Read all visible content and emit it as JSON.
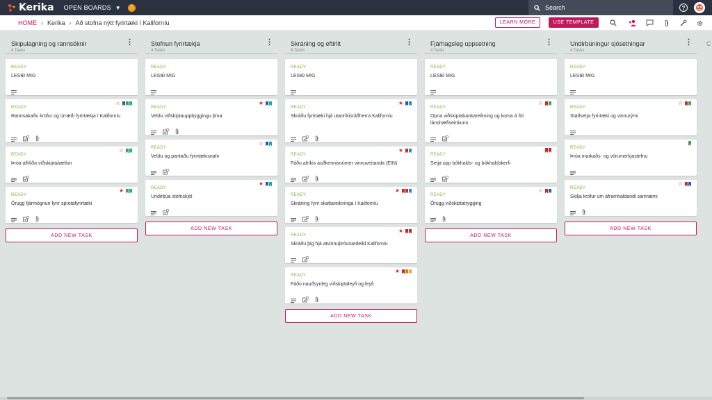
{
  "app": {
    "logo_text": "Kerika",
    "open_boards_label": "OPEN BOARDS",
    "notification_glyph": "!",
    "search_placeholder": "Search",
    "help_glyph": "?"
  },
  "colors": {
    "accent": "#c2185b",
    "ready": "#7cb342",
    "topbar": "#2c3140",
    "board_bg": "#dde3e0"
  },
  "breadcrumb": {
    "home": "HOME",
    "sep": "›",
    "items": [
      "Kerika",
      "Að stofna nýtt fyrirtæki í Kaliforníu"
    ]
  },
  "header": {
    "learn_more": "LEARN MORE",
    "use_template": "USE TEMPLATE",
    "icons": [
      "search-icon",
      "add-person-icon",
      "chat-icon",
      "attachment-icon",
      "wrench-icon",
      "settings-icon"
    ]
  },
  "add_task_label": "ADD NEW TASK",
  "columns": [
    {
      "title": "Skipulagning og rannsóknir",
      "count": "4 Tasks",
      "cards": [
        {
          "status": "READY",
          "title": "LESIÐ MIG",
          "icons": [
            "desc"
          ],
          "star": null,
          "flags": []
        },
        {
          "status": "READY",
          "title": "Rannsakaðu kröfur og úrræði fyrirtækja í Kaliforníu",
          "icons": [
            "desc",
            "check",
            "clip"
          ],
          "star": "outline",
          "flags": [
            "#1e5bb8",
            "#43a047",
            "#26a69a"
          ]
        },
        {
          "status": "READY",
          "title": "Þróa alhliða viðskiptaáætlun",
          "icons": [
            "desc",
            "check"
          ],
          "star": "outline",
          "flags": [
            "#43a047",
            "#26a69a"
          ]
        },
        {
          "status": "READY",
          "title": "Örugg fjármögnun fyrir sprotafyrirtæki",
          "icons": [
            "desc",
            "check",
            "clip"
          ],
          "star": "filled",
          "flags": [
            "#43a047",
            "#26a69a"
          ]
        }
      ]
    },
    {
      "title": "Stofnun fyrirtækja",
      "count": "4 Tasks",
      "cards": [
        {
          "status": "READY",
          "title": "LESIÐ MIG",
          "icons": [
            "desc"
          ],
          "star": null,
          "flags": []
        },
        {
          "status": "READY",
          "title": "Veldu viðskiptauppbyggingu þína",
          "icons": [
            "desc",
            "check",
            "clip"
          ],
          "star": "filled",
          "flags": [
            "#1e5bb8",
            "#26a69a"
          ]
        },
        {
          "status": "READY",
          "title": "Veldu og pantaðu fyrirtækisnafn",
          "icons": [
            "desc",
            "check"
          ],
          "star": "outline",
          "flags": [
            "#1e5bb8",
            "#26a69a"
          ]
        },
        {
          "status": "READY",
          "title": "Undirbúa stofnskjöl",
          "icons": [
            "desc",
            "check"
          ],
          "star": "filled",
          "flags": [
            "#1e5bb8",
            "#26a69a"
          ]
        }
      ]
    },
    {
      "title": "Skráning og eftirlit",
      "count": "6 Tasks",
      "cards": [
        {
          "status": "READY",
          "title": "LESIÐ MIG",
          "icons": [
            "desc"
          ],
          "star": null,
          "flags": []
        },
        {
          "status": "READY",
          "title": "Skráðu fyrirtæki hjá utanríkisráðherra Kaliforníu",
          "icons": [
            "desc",
            "check",
            "clip"
          ],
          "star": "filled",
          "flags": [
            "#1e5bb8",
            "#1e88e5"
          ]
        },
        {
          "status": "READY",
          "title": "Fáðu alríkis auðkennisnúmer vinnuveitanda (EIN)",
          "icons": [
            "desc",
            "check",
            "clip"
          ],
          "star": "filled",
          "flags": [
            "#c62828",
            "#1e88e5"
          ]
        },
        {
          "status": "READY",
          "title": "Skráning fyrir skattareikninga í Kaliforníu",
          "icons": [
            "desc",
            "check",
            "clip"
          ],
          "star": "filled",
          "flags": [
            "#c62828",
            "#c62828",
            "#1e88e5"
          ]
        },
        {
          "status": "READY",
          "title": "Skráðu þig hjá atvinnuþróunardeild Kaliforníu",
          "icons": [
            "desc",
            "check"
          ],
          "star": "filled",
          "flags": [
            "#c62828",
            "#c62828"
          ]
        },
        {
          "status": "READY",
          "title": "Fáðu nauðsynleg viðskiptaleyfi og leyfi",
          "icons": [
            "desc",
            "check",
            "clip"
          ],
          "star": "filled",
          "flags": [
            "#c62828",
            "#ef6c00",
            "#f9a825"
          ]
        }
      ]
    },
    {
      "title": "Fjárhagsleg uppsetning",
      "count": "4 Tasks",
      "cards": [
        {
          "status": "READY",
          "title": "LESIÐ MIG",
          "icons": [
            "desc"
          ],
          "star": null,
          "flags": []
        },
        {
          "status": "READY",
          "title": "Opna viðskiptabankareikning og koma á fót lánshæfiseinkunn",
          "icons": [
            "desc",
            "check"
          ],
          "star": "outline",
          "flags": [
            "#c62828",
            "#43a047"
          ]
        },
        {
          "status": "READY",
          "title": "Setja upp bókhalds- og bókhaldskerfi",
          "icons": [
            "desc",
            "check"
          ],
          "star": null,
          "flags": [
            "#c62828",
            "#c62828"
          ]
        },
        {
          "status": "READY",
          "title": "Örugg viðskiptatrygging",
          "icons": [
            "desc",
            "clip"
          ],
          "star": "outline",
          "flags": [
            "#c62828",
            "#1e5bb8"
          ]
        }
      ]
    },
    {
      "title": "Undirbúningur sjósetningar",
      "count": "4 Tasks",
      "cards": [
        {
          "status": "READY",
          "title": "LESIÐ MIG",
          "icons": [
            "desc"
          ],
          "star": null,
          "flags": []
        },
        {
          "status": "READY",
          "title": "Staðsetja fyrirtæki og vinnurými",
          "icons": [
            "desc"
          ],
          "star": "outline",
          "flags": [
            "#c62828",
            "#43a047"
          ]
        },
        {
          "status": "READY",
          "title": "Þróa markaðs- og vörumerkjastefnu",
          "icons": [
            "desc"
          ],
          "star": null,
          "flags": [
            "#43a047"
          ]
        },
        {
          "status": "READY",
          "title": "Skilja kröfur um áframhaldandi samræmi",
          "icons": [
            "desc",
            "clip"
          ],
          "star": "outline",
          "flags": [
            "#c62828",
            "#1e5bb8"
          ]
        }
      ]
    }
  ]
}
